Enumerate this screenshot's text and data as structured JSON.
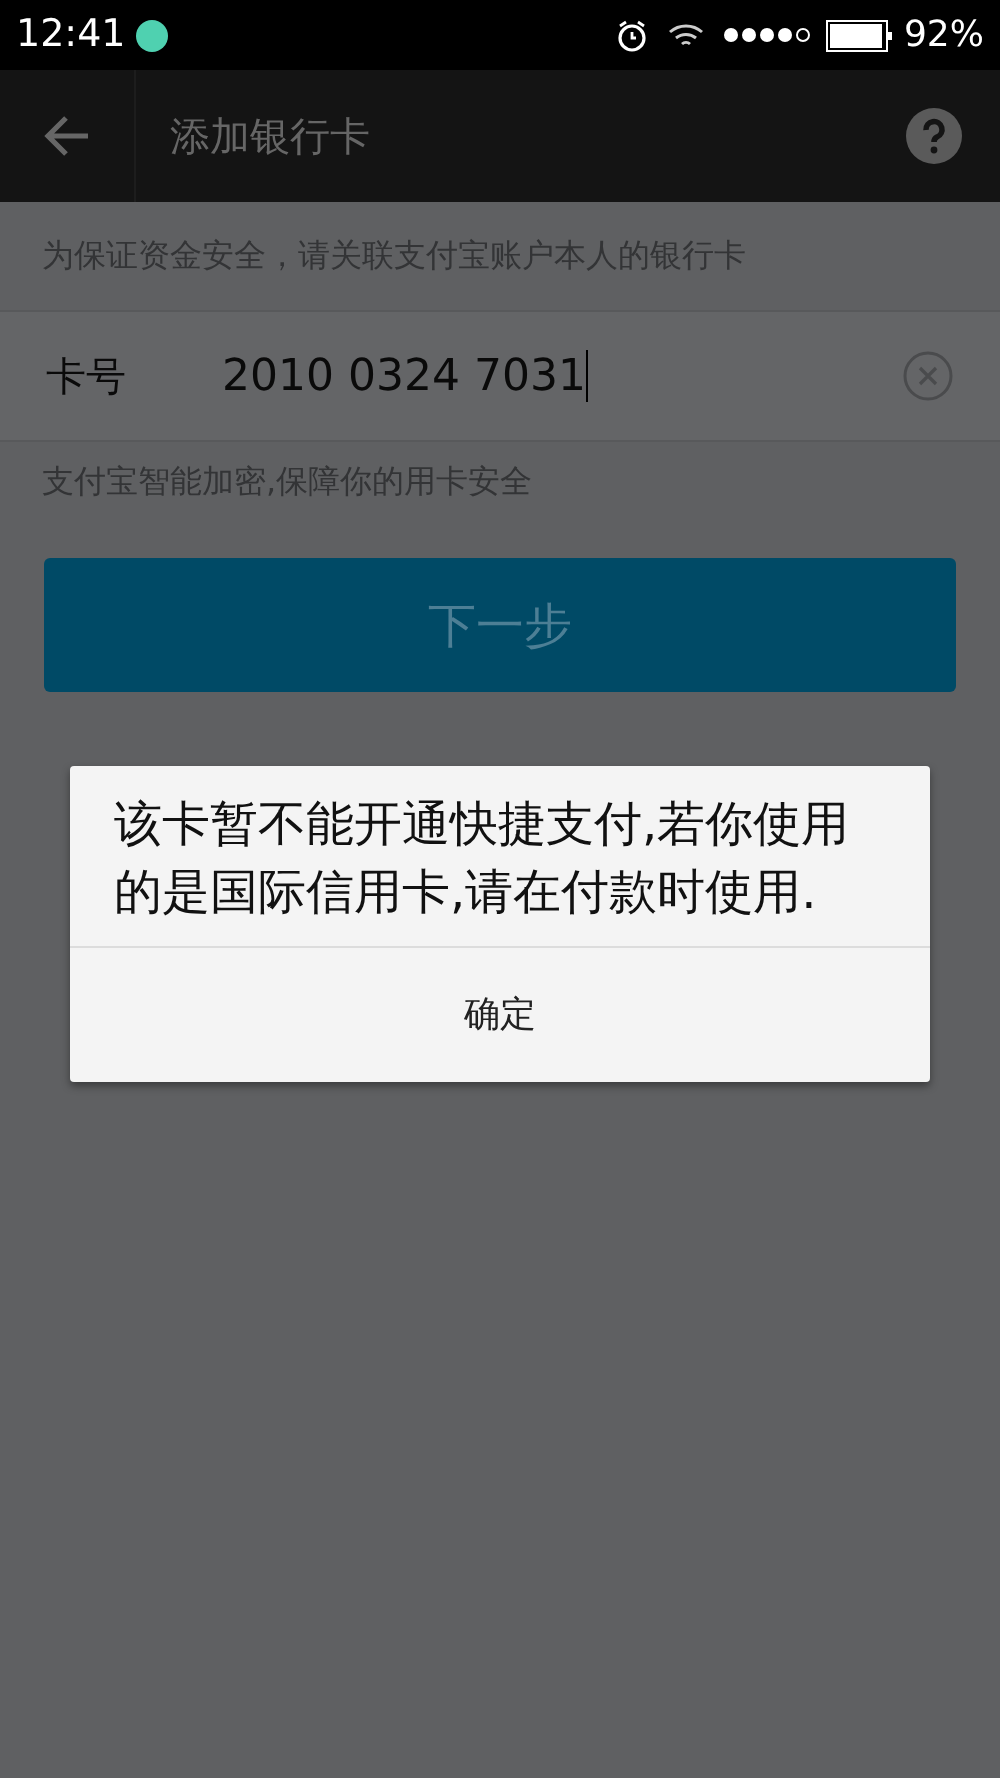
{
  "status_bar": {
    "time": "12:41",
    "battery": "92%",
    "signal_dots": [
      {
        "filled": true
      },
      {
        "filled": true
      },
      {
        "filled": true
      },
      {
        "filled": true
      },
      {
        "filled": false
      }
    ]
  },
  "header": {
    "title": "添加银行卡"
  },
  "notice": "为保证资金安全，请关联支付宝账户本人的银行卡",
  "card_field": {
    "label": "卡号",
    "value": "2010 0324 7031"
  },
  "security_note": "支付宝智能加密,保障你的用卡安全",
  "next_button": {
    "label": "下一步",
    "disabled": true
  },
  "dialog": {
    "message": "该卡暂不能开通快捷支付,若你使用的是国际信用卡,请在付款时使用.",
    "button": "确定"
  }
}
